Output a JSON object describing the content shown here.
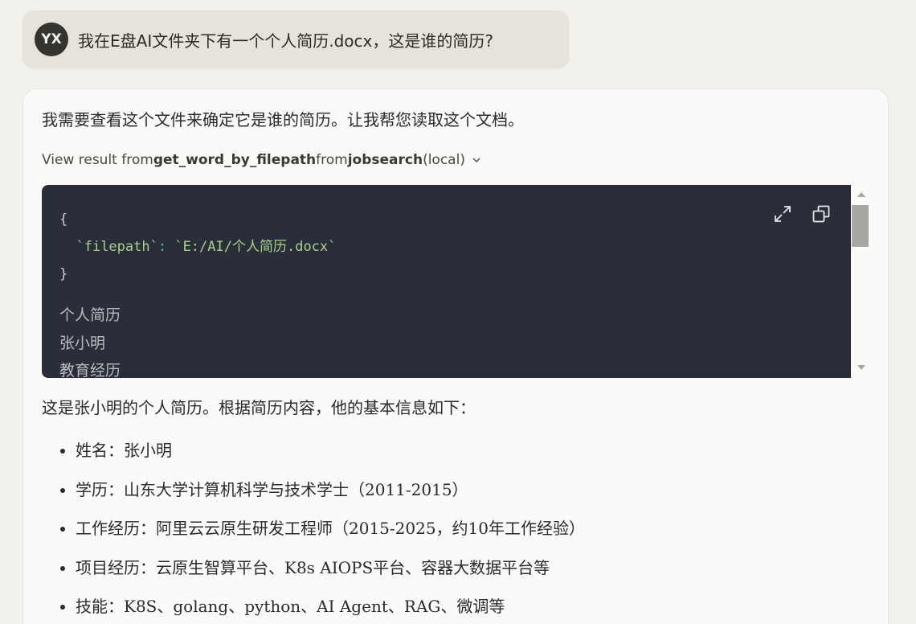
{
  "user_message": {
    "avatar_initials": "YX",
    "text": "我在E盘AI文件夹下有一个个人简历.docx，这是谁的简历?"
  },
  "assistant": {
    "intro": "我需要查看这个文件来确定它是谁的简历。让我帮您读取这个文档。",
    "tool_call": {
      "prefix": "View result from ",
      "tool_name": "get_word_by_filepath",
      "middle": " from ",
      "server": "jobsearch",
      "suffix": " (local)",
      "chevron_icon": "chevron-down-icon"
    },
    "code": {
      "open_brace": "{",
      "key": "`filepath`",
      "colon": ": ",
      "value": "`E:/AI/个人简历.docx`",
      "close_brace": "}"
    },
    "result_lines": [
      "个人简历",
      "张小明",
      "教育经历"
    ],
    "summary": "这是张小明的个人简历。根据简历内容，他的基本信息如下：",
    "bullets": [
      "姓名：张小明",
      "学历：山东大学计算机科学与技术学士（2011-2015）",
      "工作经历：阿里云云原生研发工程师（2015-2025，约10年工作经验）",
      "项目经历：云原生智算平台、K8s AIOPS平台、容器大数据平台等",
      "技能：K8S、golang、python、AI Agent、RAG、微调等"
    ]
  },
  "colors": {
    "page_bg": "#f3f1ec",
    "user_bubble": "#e6e3da",
    "code_bg": "#2a2e38",
    "code_string": "#a8d08d"
  }
}
